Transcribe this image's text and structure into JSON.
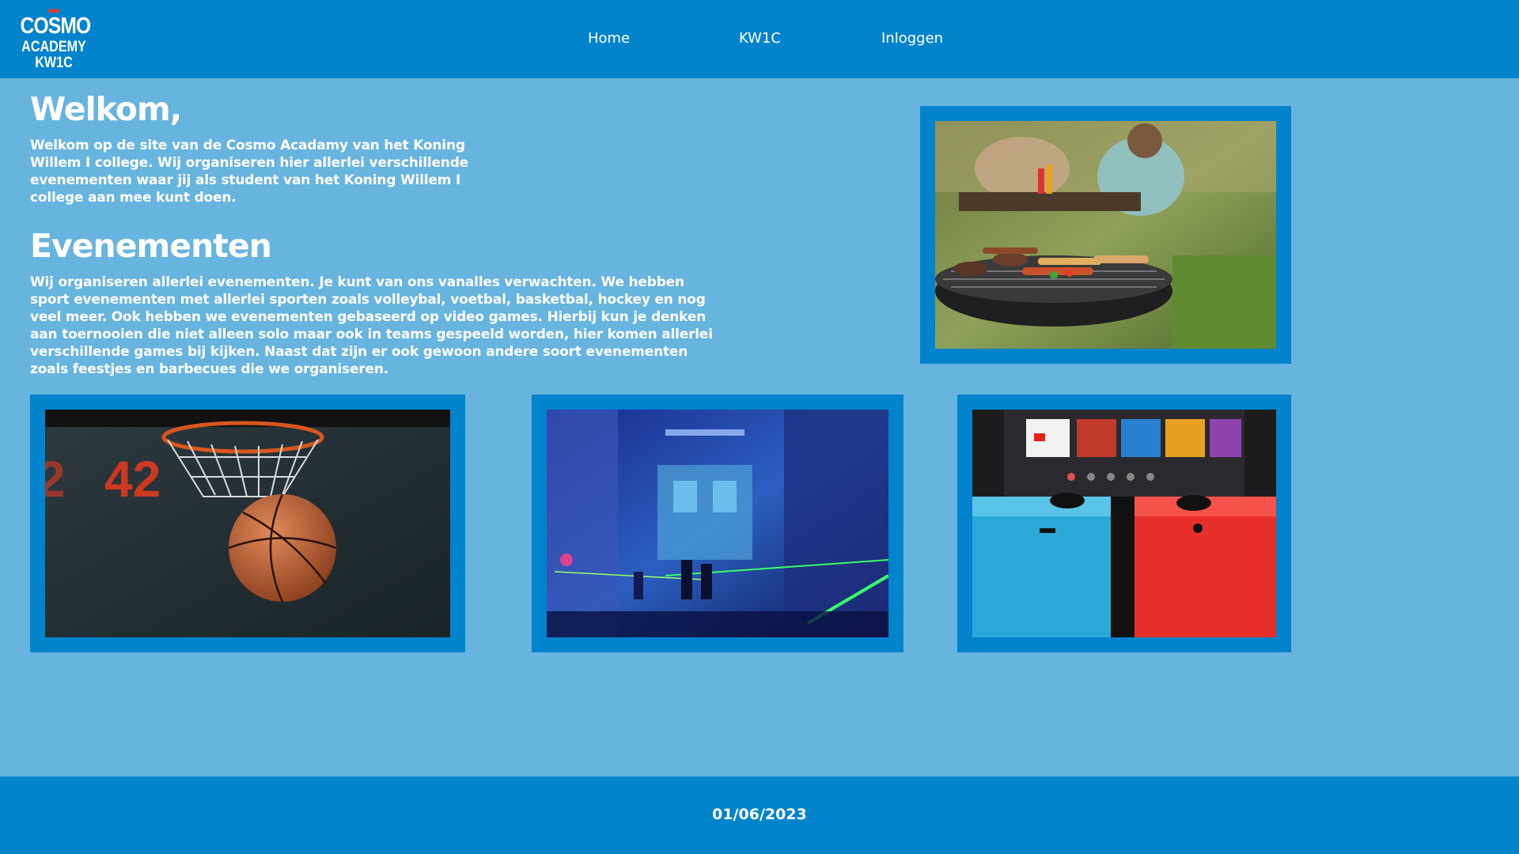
{
  "header": {
    "logo": {
      "line1": "COSMO",
      "line2": "ACADEMY",
      "line3": "KW1C"
    },
    "nav": [
      {
        "label": "Home"
      },
      {
        "label": "KW1C"
      },
      {
        "label": "Inloggen"
      }
    ]
  },
  "welcome": {
    "title": "Welkom,",
    "text": "Welkom op de site van de Cosmo Acadamy van het Koning Willem I college. Wij organiseren hier allerlei verschillende evenementen waar jij als student van het Koning Willem I college aan mee kunt doen."
  },
  "events": {
    "title": "Evenementen",
    "text": "Wij organiseren allerlei evenementen. Je kunt van ons vanalles verwachten. We hebben sport evenementen met allerlei sporten zoals volleybal, voetbal, basketbal, hockey en nog veel meer. Ook hebben we evenementen gebaseerd op video games. Hierbij kun je denken aan toernooien die niet alleen solo maar ook in teams gespeeld worden, hier komen allerlei verschillende games bij kijken. Naast dat zijn er ook gewoon andere soort evenementen zoals feestjes en barbecues die we organiseren."
  },
  "footer": {
    "date": "01/06/2023"
  },
  "colors": {
    "primary": "#0283cb",
    "background": "#67b4df",
    "text": "#ffffff"
  }
}
